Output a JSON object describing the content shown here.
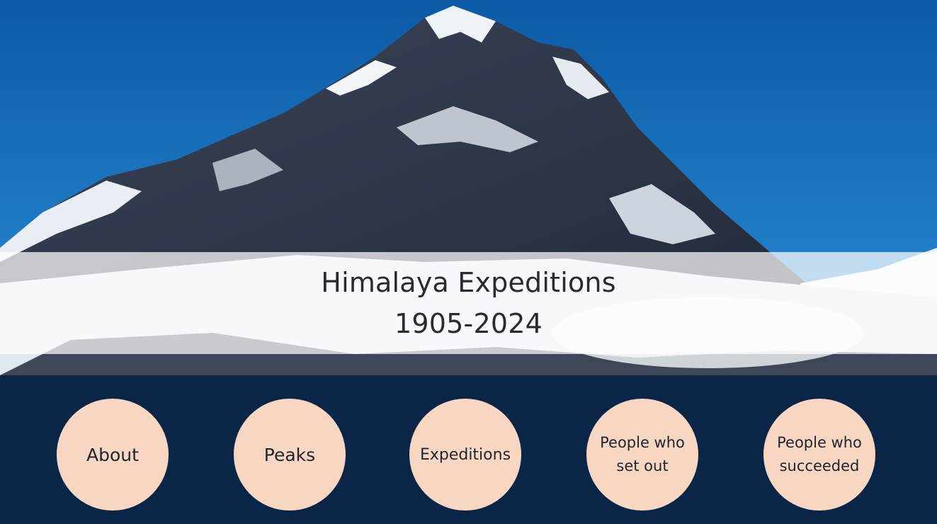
{
  "banner": {
    "title_line1": "Himalaya Expeditions",
    "title_line2": "1905-2024"
  },
  "nav": {
    "items": [
      {
        "label": "About"
      },
      {
        "label": "Peaks"
      },
      {
        "label": "Expeditions"
      },
      {
        "label": "People who set out"
      },
      {
        "label": "People who succeeded"
      }
    ]
  },
  "colors": {
    "sky": "#0a5ea8",
    "nav_background": "#0b2547",
    "circle_fill": "#f8d7c2",
    "text": "#262a33"
  }
}
